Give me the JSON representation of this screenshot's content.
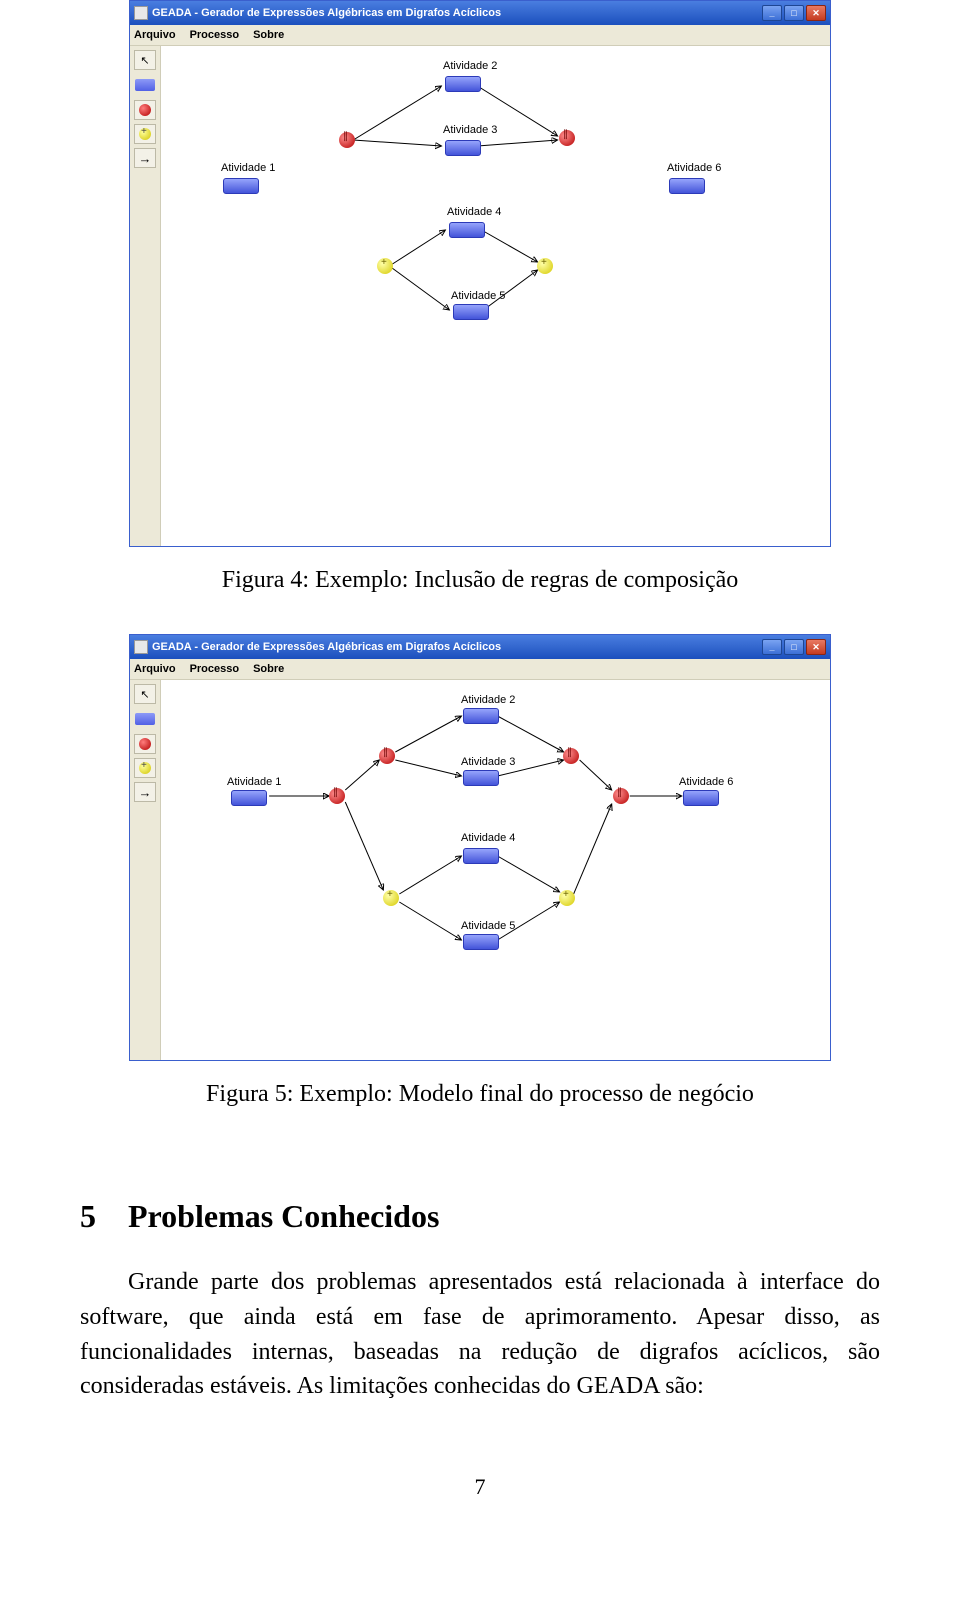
{
  "app": {
    "title": "GEADA - Gerador de Expressões Algébricas em Digrafos Acíclicos"
  },
  "menu": {
    "arquivo": "Arquivo",
    "processo": "Processo",
    "sobre": "Sobre"
  },
  "activities": {
    "a1": "Atividade 1",
    "a2": "Atividade 2",
    "a3": "Atividade 3",
    "a4": "Atividade 4",
    "a5": "Atividade 5",
    "a6": "Atividade 6"
  },
  "captions": {
    "fig4": "Figura 4: Exemplo: Inclusão de regras de composição",
    "fig5": "Figura 5: Exemplo: Modelo final do processo de negócio"
  },
  "section": {
    "number": "5",
    "title": "Problemas Conhecidos"
  },
  "paragraph": "Grande parte dos problemas apresentados está relacionada à interface do software, que ainda está em fase de aprimoramento. Apesar disso, as funcionalidades internas, baseadas na redução de digrafos acíclicos, são consideradas estáveis. As limitações conhecidas do GEADA são:",
  "page_number": "7"
}
